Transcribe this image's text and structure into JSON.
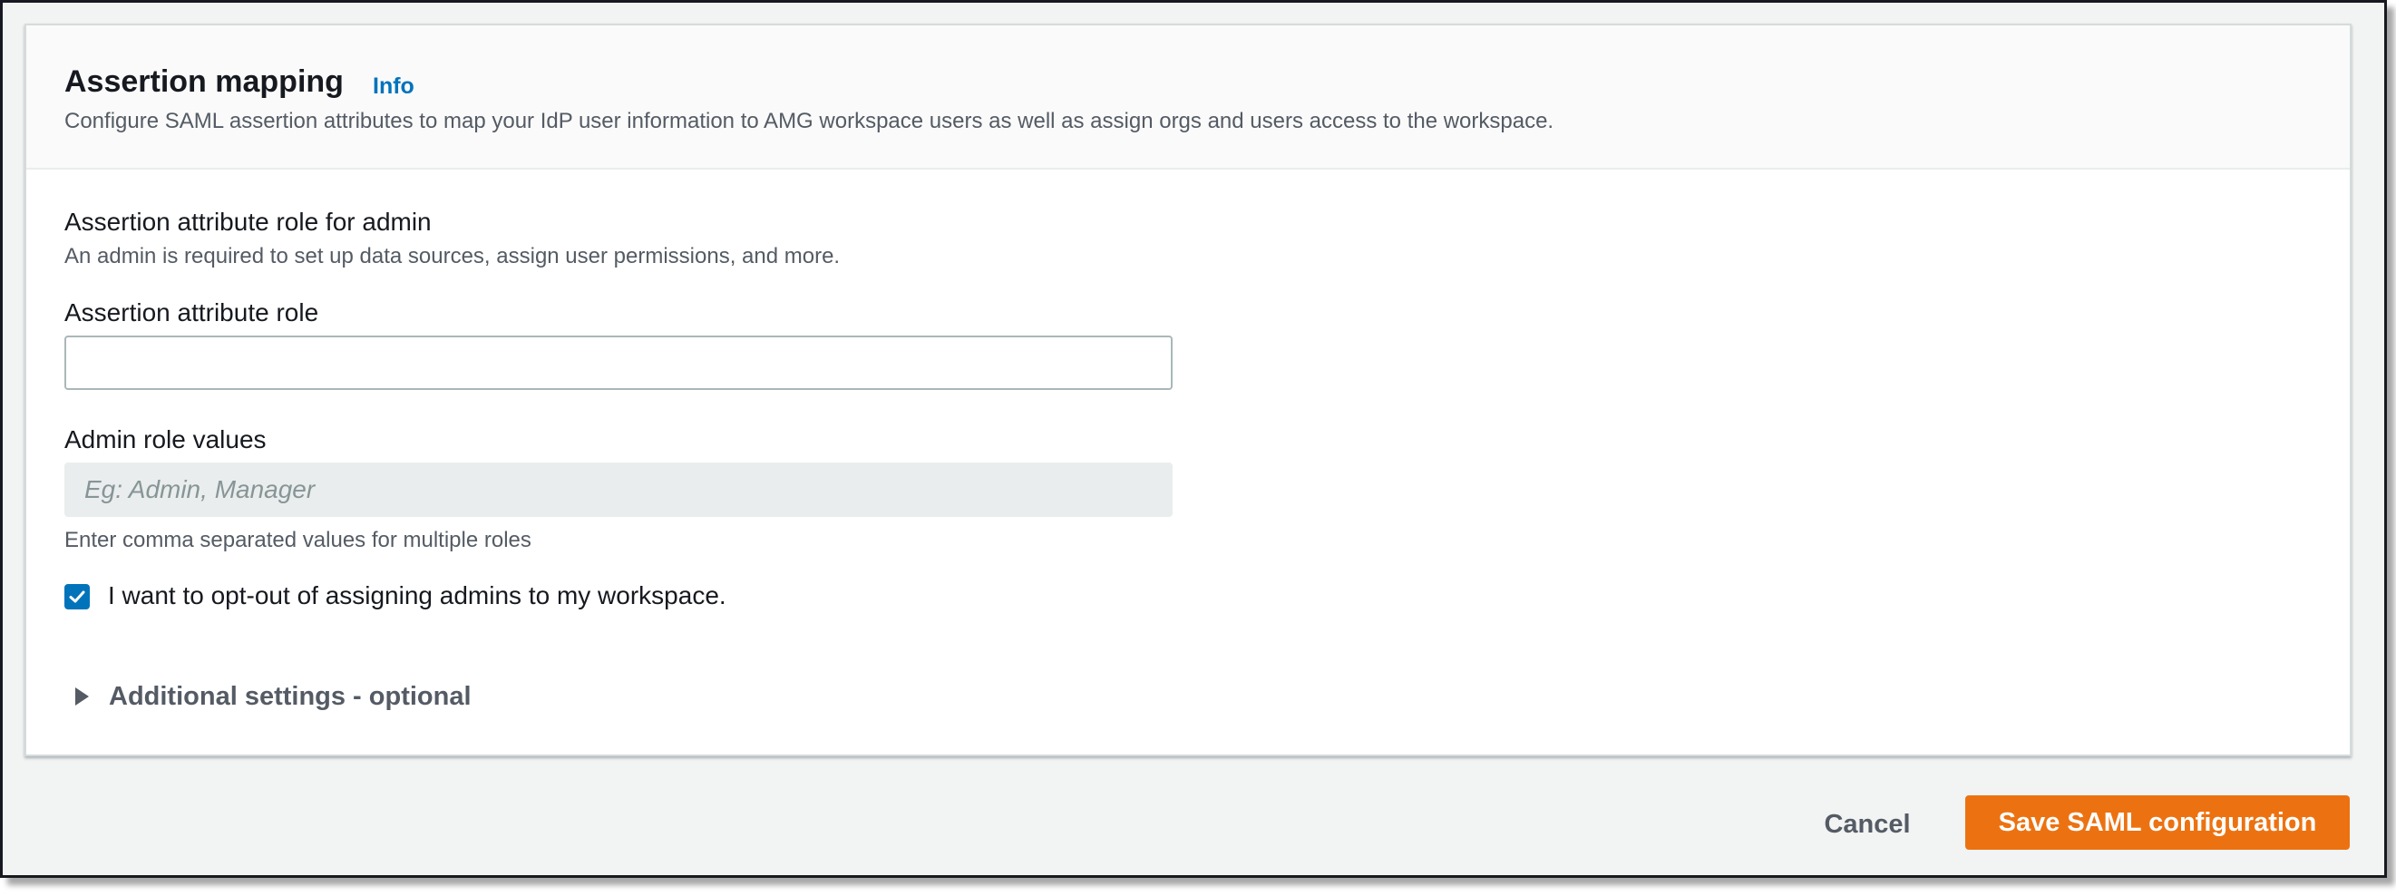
{
  "header": {
    "title": "Assertion mapping",
    "info_link": "Info",
    "description": "Configure SAML assertion attributes to map your IdP user information to AMG workspace users as well as assign orgs and users access to the workspace."
  },
  "admin_section": {
    "title": "Assertion attribute role for admin",
    "description": "An admin is required to set up data sources, assign user permissions, and more."
  },
  "role_field": {
    "label": "Assertion attribute role",
    "value": ""
  },
  "admin_values_field": {
    "label": "Admin role values",
    "placeholder": "Eg: Admin, Manager",
    "hint": "Enter comma separated values for multiple roles",
    "disabled": true
  },
  "opt_out": {
    "label": "I want to opt-out of assigning admins to my workspace.",
    "checked": true
  },
  "additional_settings": {
    "label": "Additional settings - optional",
    "expanded": false
  },
  "footer": {
    "cancel_label": "Cancel",
    "save_label": "Save SAML configuration"
  },
  "colors": {
    "primary_button": "#ec7211",
    "link": "#0073bb",
    "checkbox": "#0073bb"
  },
  "icons": {
    "checkbox": "check-icon",
    "expander": "caret-right-icon"
  }
}
